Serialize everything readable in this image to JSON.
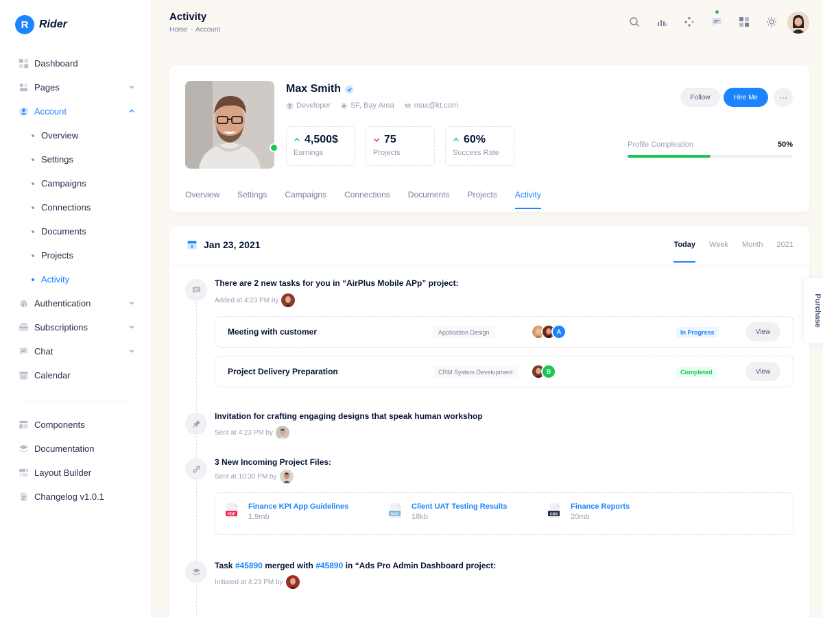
{
  "brand": {
    "logo_letter": "R",
    "name": "Rider",
    "accent": "#1b84ff"
  },
  "sidebar": {
    "items": [
      {
        "label": "Dashboard",
        "icon": "dashboard-icon"
      },
      {
        "label": "Pages",
        "icon": "pages-icon"
      },
      {
        "label": "Account",
        "icon": "account-icon"
      },
      {
        "label": "Authentication",
        "icon": "fingerprint-icon"
      },
      {
        "label": "Subscriptions",
        "icon": "subscriptions-icon"
      },
      {
        "label": "Chat",
        "icon": "chat-icon"
      },
      {
        "label": "Calendar",
        "icon": "calendar-icon"
      }
    ],
    "calendar_day": "31",
    "account_sub": [
      "Overview",
      "Settings",
      "Campaigns",
      "Connections",
      "Documents",
      "Projects",
      "Activity"
    ],
    "bottom": [
      {
        "label": "Components",
        "icon": "components-icon"
      },
      {
        "label": "Documentation",
        "icon": "documentation-icon"
      },
      {
        "label": "Layout Builder",
        "icon": "layout-builder-icon"
      },
      {
        "label": "Changelog v1.0.1",
        "icon": "changelog-icon"
      }
    ]
  },
  "header": {
    "title": "Activity",
    "breadcrumb": [
      "Home",
      "-",
      "Account"
    ]
  },
  "profile": {
    "name": "Max Smith",
    "role": "Developer",
    "location": "SF, Bay Area",
    "email": "max@kt.com",
    "stats": [
      {
        "value": "4,500$",
        "label": "Earnings",
        "trend": "up"
      },
      {
        "value": "75",
        "label": "Projects",
        "trend": "down"
      },
      {
        "value": "60%",
        "label": "Success Rate",
        "trend": "up"
      }
    ],
    "follow_label": "Follow",
    "hire_label": "Hire Me",
    "more_label": "···",
    "completion_label": "Profile Compleation",
    "completion_value": "50%",
    "completion_fraction": 0.5,
    "tabs": [
      "Overview",
      "Settings",
      "Campaigns",
      "Connections",
      "Documents",
      "Projects",
      "Activity"
    ]
  },
  "activity": {
    "date": "Jan 23, 2021",
    "calendar_day": "8",
    "periods": [
      "Today",
      "Week",
      "Month",
      "2021"
    ],
    "item1": {
      "title": "There are 2 new tasks for you in “AirPlus Mobile APp” project:",
      "meta": "Added at 4:23 PM by",
      "tasks": [
        {
          "name": "Meeting with customer",
          "tag": "Application Design",
          "avatar_letter": "A",
          "status": "In Progress",
          "status_color": "#1b84ff",
          "view": "View"
        },
        {
          "name": "Project Delivery Preparation",
          "tag": "CRM System Development",
          "avatar_letter": "B",
          "status": "Completed",
          "status_color": "#17c653",
          "view": "View"
        }
      ]
    },
    "item2": {
      "title": "Invitation for crafting engaging designs that speak human workshop",
      "meta": "Sent at 4:23 PM by"
    },
    "item3": {
      "title": "3 New Incoming Project Files:",
      "meta": "Sent at 10:30 PM by",
      "files": [
        {
          "name": "Finance KPI App Guidelines",
          "size": "1.9mb",
          "type": "PDF"
        },
        {
          "name": "Client UAT Testing Results",
          "size": "18kb",
          "type": "DOC"
        },
        {
          "name": "Finance Reports",
          "size": "20mb",
          "type": "CSS"
        }
      ]
    },
    "item4": {
      "prefix": "Task",
      "task_link": "#45890",
      "middle": "merged with",
      "merge_link": "#45890",
      "suffix": "in “Ads Pro Admin Dashboard project:",
      "meta": "Initiated at 4:23 PM by"
    }
  },
  "purchase_label": "Purchase"
}
